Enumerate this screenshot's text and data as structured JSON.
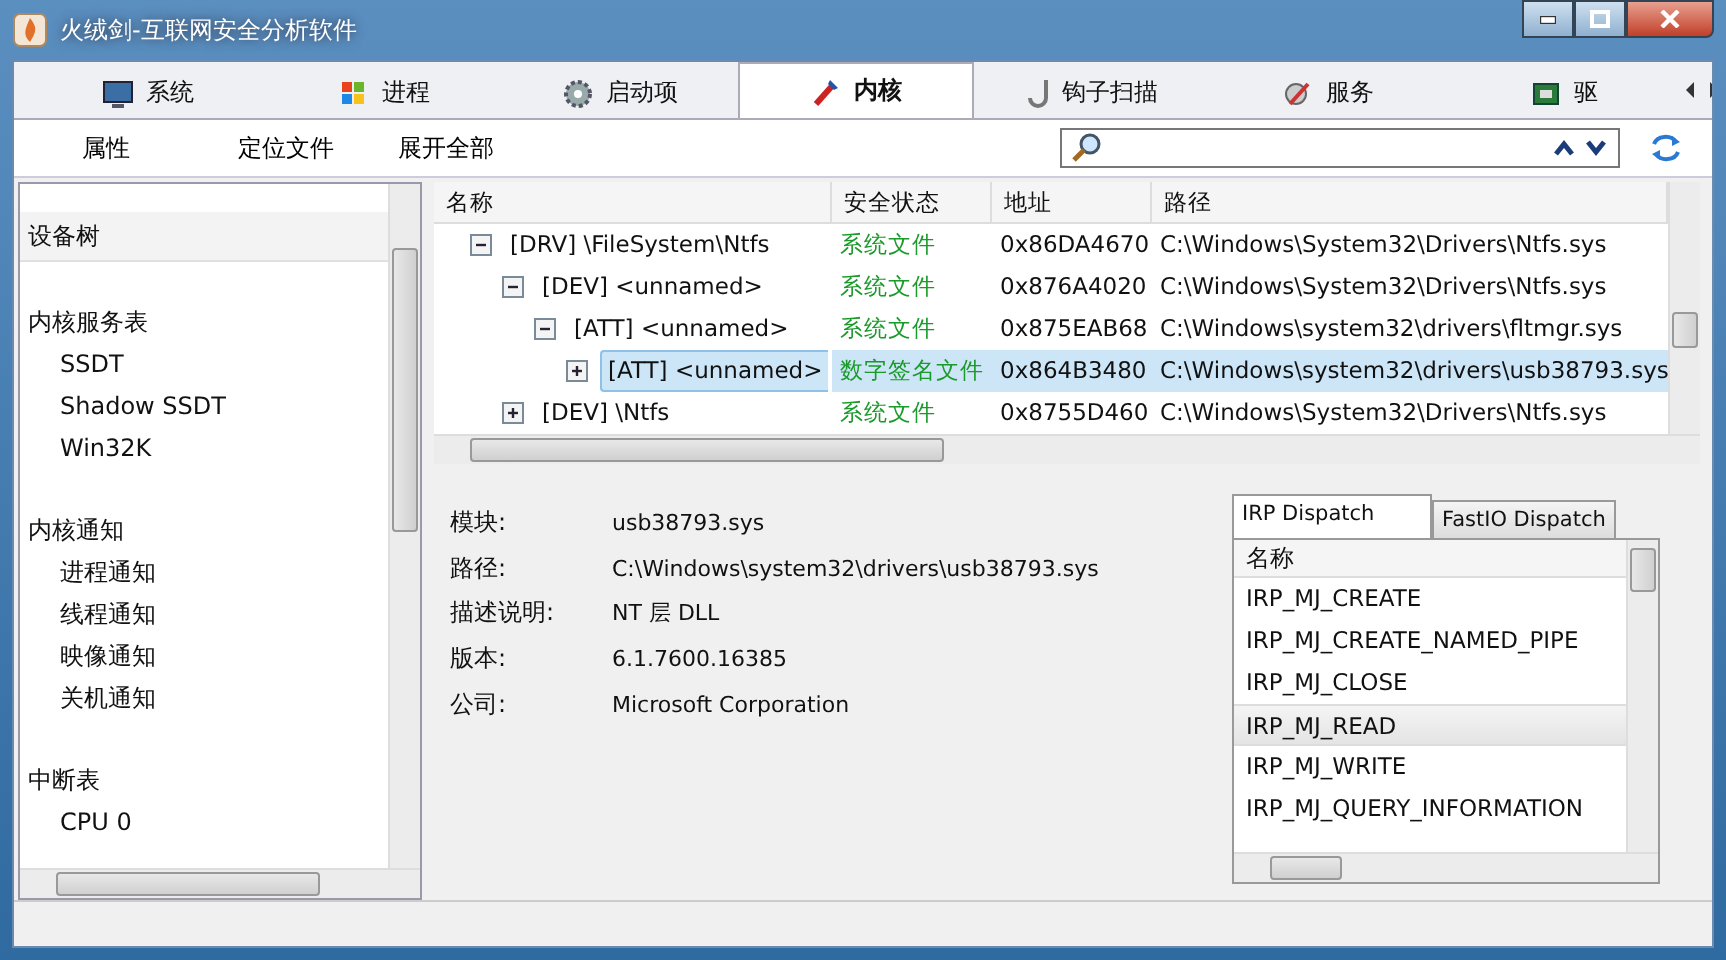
{
  "window": {
    "title": "火绒剑-互联网安全分析软件"
  },
  "tabs": [
    {
      "label": "系统",
      "selected": false
    },
    {
      "label": "进程",
      "selected": false
    },
    {
      "label": "启动项",
      "selected": false
    },
    {
      "label": "内核",
      "selected": true
    },
    {
      "label": "钩子扫描",
      "selected": false
    },
    {
      "label": "服务",
      "selected": false
    },
    {
      "label": "驱",
      "selected": false
    }
  ],
  "toolbar": {
    "buttons": [
      "属性",
      "定位文件",
      "展开全部"
    ]
  },
  "sidebar": {
    "header": "设备树",
    "groups": [
      {
        "title": "内核服务表",
        "items": [
          "SSDT",
          "Shadow SSDT",
          "Win32K"
        ]
      },
      {
        "title": "内核通知",
        "items": [
          "进程通知",
          "线程通知",
          "映像通知",
          "关机通知"
        ]
      },
      {
        "title": "中断表",
        "items": [
          "CPU 0"
        ]
      }
    ]
  },
  "tree": {
    "columns": [
      "名称",
      "安全状态",
      "地址",
      "路径"
    ],
    "rows": [
      {
        "name": "[DRV] \\FileSystem\\Ntfs",
        "status": "系统文件",
        "address": "0x86DA4670",
        "path": "C:\\Windows\\System32\\Drivers\\Ntfs.sys",
        "expanded": true,
        "selected": false,
        "children": [
          {
            "name": "[DEV] <unnamed>",
            "status": "系统文件",
            "address": "0x876A4020",
            "path": "C:\\Windows\\System32\\Drivers\\Ntfs.sys",
            "expanded": true,
            "selected": false,
            "children": [
              {
                "name": "[ATT] <unnamed>",
                "status": "系统文件",
                "address": "0x875EAB68",
                "path": "C:\\Windows\\system32\\drivers\\fltmgr.sys",
                "expanded": true,
                "selected": false,
                "children": [
                  {
                    "name": "[ATT] <unnamed>",
                    "status": "数字签名文件",
                    "address": "0x864B3480",
                    "path": "C:\\Windows\\system32\\drivers\\usb38793.sys",
                    "expanded": false,
                    "selected": true
                  }
                ]
              }
            ]
          },
          {
            "name": "[DEV] \\Ntfs",
            "status": "系统文件",
            "address": "0x8755D460",
            "path": "C:\\Windows\\System32\\Drivers\\Ntfs.sys",
            "expanded": false,
            "selected": false
          }
        ]
      }
    ]
  },
  "details": [
    {
      "label": "模块:",
      "value": "usb38793.sys"
    },
    {
      "label": "路径:",
      "value": "C:\\Windows\\system32\\drivers\\usb38793.sys"
    },
    {
      "label": "描述说明:",
      "value": "NT 层 DLL"
    },
    {
      "label": "版本:",
      "value": "6.1.7600.16385"
    },
    {
      "label": "公司:",
      "value": "Microsoft Corporation"
    }
  ],
  "dispatch": {
    "tabs": [
      {
        "label": "IRP Dispatch",
        "selected": true
      },
      {
        "label": "FastIO Dispatch",
        "selected": false
      }
    ],
    "column": "名称",
    "items": [
      {
        "name": "IRP_MJ_CREATE",
        "selected": false
      },
      {
        "name": "IRP_MJ_CREATE_NAMED_PIPE",
        "selected": false
      },
      {
        "name": "IRP_MJ_CLOSE",
        "selected": false
      },
      {
        "name": "IRP_MJ_READ",
        "selected": true
      },
      {
        "name": "IRP_MJ_WRITE",
        "selected": false
      },
      {
        "name": "IRP_MJ_QUERY_INFORMATION",
        "selected": false
      }
    ]
  }
}
